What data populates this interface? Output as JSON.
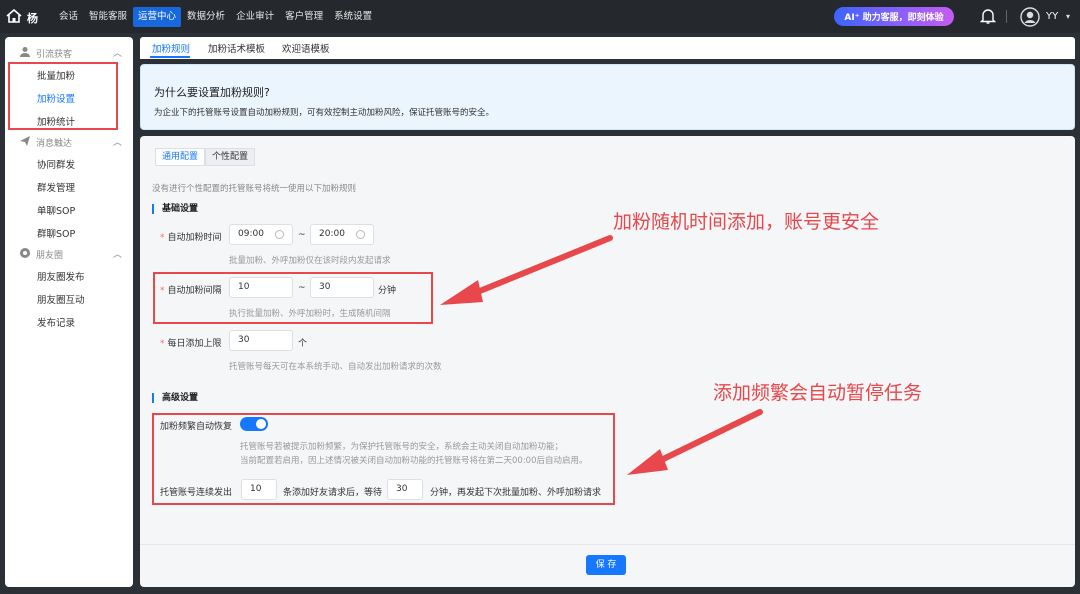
{
  "topbar": {
    "brand": "杨",
    "nav": [
      "会话",
      "智能客服",
      "运营中心",
      "数据分析",
      "企业审计",
      "客户管理",
      "系统设置"
    ],
    "active_nav": "运营中心",
    "ai_button": "AI⁺  助力客服，即刻体验",
    "username": "YY"
  },
  "sidebar": {
    "groups": [
      {
        "title": "引流获客",
        "icon": "user-icon",
        "items": [
          "批量加粉",
          "加粉设置",
          "加粉统计"
        ]
      },
      {
        "title": "消息触达",
        "icon": "send-icon",
        "items": [
          "协同群发",
          "群发管理",
          "单聊SOP",
          "群聊SOP"
        ]
      },
      {
        "title": "朋友圈",
        "icon": "moments-icon",
        "items": [
          "朋友圈发布",
          "朋友圈互动",
          "发布记录"
        ]
      }
    ],
    "active_item": "加粉设置"
  },
  "tabs": [
    "加粉规则",
    "加粉话术模板",
    "欢迎语模板"
  ],
  "info": {
    "title": "为什么要设置加粉规则?",
    "desc": "为企业下的托管账号设置自动加粉规则，可有效控制主动加粉风险，保证托管账号的安全。"
  },
  "subtabs": [
    "通用配置",
    "个性配置"
  ],
  "hint_top": "没有进行个性配置的托管账号将统一使用以下加粉规则",
  "basic": {
    "title": "基础设置",
    "auto_time_label": "自动加粉时间",
    "time_start": "09:00",
    "time_end": "20:00",
    "time_help": "批量加粉、外呼加粉仅在该时段内发起请求",
    "interval_label": "自动加粉间隔",
    "interval_min": "10",
    "interval_max": "30",
    "interval_unit": "分钟",
    "interval_help": "执行批量加粉、外呼加粉时，生成随机间隔",
    "daily_label": "每日添加上限",
    "daily_value": "30",
    "daily_unit": "个",
    "daily_help": "托管账号每天可在本系统手动、自动发出加粉请求的次数",
    "tilde": "~"
  },
  "advanced": {
    "title": "高级设置",
    "auto_resume_label": "加粉频繁自动恢复",
    "auto_resume_on": true,
    "help_line1": "托管账号若被提示加粉频繁，为保护托管账号的安全，系统会主动关闭自动加粉功能；",
    "help_line2": "当前配置若启用，因上述情况被关闭自动加粉功能的托管账号将在第二天00:00后自动启用。",
    "consec_label": "托管账号连续发出",
    "consec_value": "10",
    "consec_mid": "条添加好友请求后，等待",
    "wait_value": "30",
    "wait_suffix": "分钟，再发起下次批量加粉、外呼加粉请求"
  },
  "save_label": "保 存",
  "annotations": {
    "note1": "加粉随机时间添加，账号更安全",
    "note2": "添加频繁会自动暂停任务"
  },
  "colors": {
    "accent": "#1677ff",
    "annotation": "#e8474b",
    "topbar": "#25282d"
  }
}
